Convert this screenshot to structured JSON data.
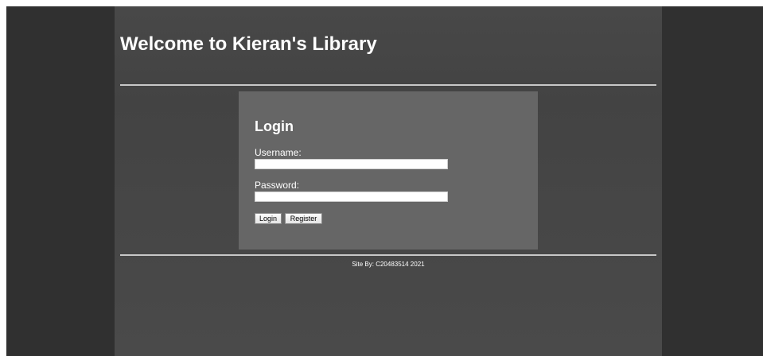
{
  "header": {
    "title": "Welcome to Kieran's Library"
  },
  "login": {
    "heading": "Login",
    "username_label": "Username:",
    "username_value": "",
    "password_label": "Password:",
    "password_value": "",
    "login_button": "Login",
    "register_button": "Register"
  },
  "footer": {
    "text": "Site By: C20483514 2021"
  },
  "colors": {
    "outer_background": "#303030",
    "main_background": "#484848",
    "panel_background": "#666666",
    "rule": "#c8c8c8",
    "text": "#ffffff"
  }
}
